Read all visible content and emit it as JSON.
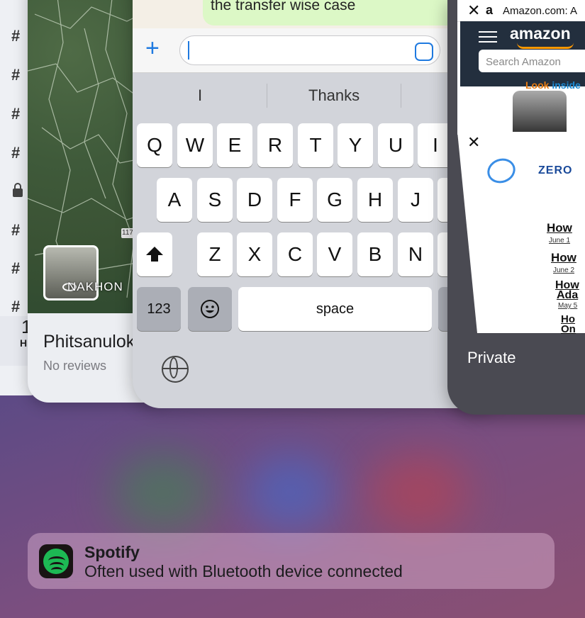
{
  "left_card": {
    "hashes": [
      "#",
      "#",
      "#",
      "#",
      "#",
      "#",
      "#"
    ],
    "footer_digit": "1",
    "footer_letter": "H"
  },
  "maps_card": {
    "map_label": "NAKHON",
    "map_pin": "117",
    "place_title": "Phitsanulok",
    "place_subtitle": "No reviews"
  },
  "messages_card": {
    "bubble_text": "the transfer wise case",
    "input_value": "",
    "suggestions": [
      "I",
      "Thanks",
      ""
    ],
    "keyboard": {
      "row1": [
        "Q",
        "W",
        "E",
        "R",
        "T",
        "Y",
        "U",
        "I"
      ],
      "row2": [
        "A",
        "S",
        "D",
        "F",
        "G",
        "H",
        "J"
      ],
      "row3": [
        "Z",
        "X",
        "C",
        "V",
        "B",
        "N"
      ],
      "numbers_key": "123",
      "space_key": "space"
    }
  },
  "browser_card": {
    "tab1_title": "Amazon.com: A",
    "amazon_logo": "amazon",
    "search_placeholder": "Search Amazon",
    "banner_look": "Look",
    "banner_inside": "inside",
    "zero_logo_text": "ZERO",
    "headlines": [
      "How",
      "How",
      "How",
      "Ada",
      "Ho",
      "On"
    ],
    "dates": [
      "June 1",
      "June 2",
      "May 5"
    ],
    "mode_label": "Private"
  },
  "suggestion": {
    "app_name": "Spotify",
    "reason": "Often used with Bluetooth device connected",
    "brand_color": "#1db954"
  }
}
